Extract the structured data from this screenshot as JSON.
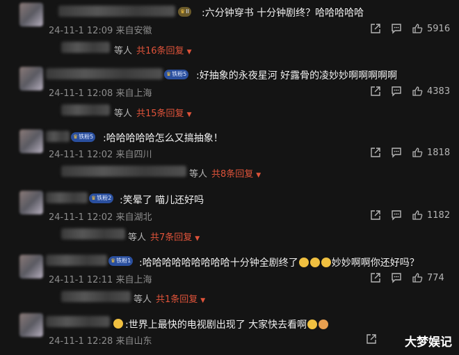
{
  "comments": [
    {
      "text": ":六分钟穿书 十分钟剧终？哈哈哈哈哈",
      "date": "24-11-1 12:09",
      "location": "来自安徽",
      "likes": "5916",
      "badge": "II",
      "replies_prefix": "等人",
      "replies_label": "共16条回复"
    },
    {
      "text": ":好抽象的永夜星河 好露骨的凌妙妙啊啊啊啊啊",
      "date": "24-11-1 12:08",
      "location": "来自上海",
      "likes": "4383",
      "badge": "铁粉5",
      "replies_prefix": "等人",
      "replies_label": "共15条回复"
    },
    {
      "text": ":哈哈哈哈哈怎么又搞抽象！",
      "date": "24-11-1 12:02",
      "location": "来自四川",
      "likes": "1818",
      "badge": "铁粉5",
      "replies_prefix": "等人",
      "replies_label": "共8条回复"
    },
    {
      "text": ":笑晕了 喵儿还好吗",
      "date": "24-11-1 12:02",
      "location": "来自湖北",
      "likes": "1182",
      "badge": "铁粉2",
      "replies_prefix": "等人",
      "replies_label": "共7条回复"
    },
    {
      "text_before": ":哈哈哈哈哈哈哈哈哈十分钟全剧终了",
      "text_after": "妙妙啊啊你还好吗？",
      "date": "24-11-1 12:11",
      "location": "来自上海",
      "likes": "774",
      "badge": "铁粉1",
      "replies_prefix": "等人",
      "replies_label": "共1条回复"
    },
    {
      "text": ":世界上最快的电视剧出现了 大家快去看啊",
      "date": "24-11-1 12:28",
      "location": "来自山东",
      "likes": ""
    }
  ],
  "icons": {
    "share": "share-icon",
    "comment": "comment-icon",
    "like": "thumbs-up-icon",
    "caret": "caret-down-icon"
  },
  "watermark": "大梦娱记",
  "colors": {
    "background": "#141414",
    "reply_link": "#e0533a",
    "meta": "#8d8d8d"
  }
}
